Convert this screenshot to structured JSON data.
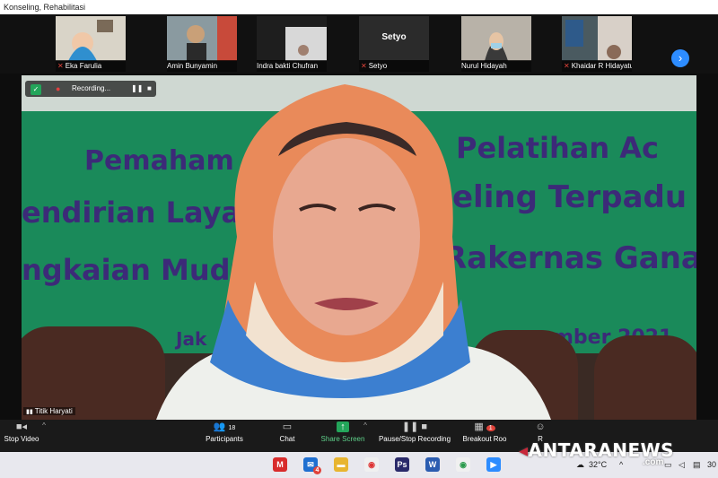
{
  "window": {
    "title": "Konseling, Rehabilitasi"
  },
  "participants": [
    {
      "name": "Eka Farulia",
      "muted": true
    },
    {
      "name": "Amin Bunyamin",
      "muted": false
    },
    {
      "name": "Indra bakti Chufran",
      "muted": false
    },
    {
      "name": "Setyo",
      "muted": true,
      "center_label": "Setyo"
    },
    {
      "name": "Nurul Hidayah",
      "muted": false
    },
    {
      "name": "Khaidar R Hidayatullah",
      "muted": true
    }
  ],
  "recording": {
    "label": "Recording..."
  },
  "banner": {
    "line1a": "Pemaham",
    "line1b": "Pelatihan Ac",
    "line2a": "endirian Laya",
    "line2b": "eling Terpadu",
    "line3a": "ngkaian Mudz",
    "line3b": "Rakernas Gana",
    "line4a": "Jak",
    "line4b": "mber 2021"
  },
  "speaker": {
    "name": "Titik Haryati"
  },
  "toolbar": {
    "stop_video": "Stop Video",
    "participants": "Participants",
    "participants_count": "18",
    "chat": "Chat",
    "share_screen": "Share Screen",
    "pause_stop_recording": "Pause/Stop Recording",
    "breakout_rooms": "Breakout Roo",
    "breakout_badge": "1",
    "reactions": "R"
  },
  "taskbar": {
    "temperature": "32°C",
    "clock": "30",
    "mail_badge": "4"
  },
  "watermark": {
    "brand": "ANTARANEWS",
    "suffix": ".com"
  },
  "colors": {
    "accent": "#2d8cff",
    "share": "#23a55a",
    "muted": "#e0433a",
    "banner_text": "#3c2a78",
    "banner_bg": "#1a8a5a"
  }
}
